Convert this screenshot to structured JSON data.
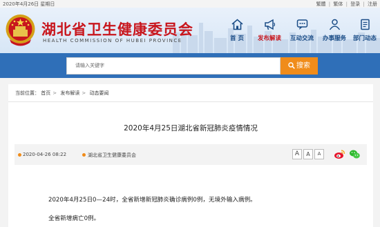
{
  "topbar": {
    "date": "2020年4月26日 星期日",
    "links": [
      "繁體",
      "繁体",
      "登录",
      "注册"
    ]
  },
  "header": {
    "title": "湖北省卫生健康委员会",
    "subtitle": "HEALTH COMMISSION OF HUBEI PROVINCE",
    "nav": [
      {
        "label": "首 页",
        "icon": "home-icon"
      },
      {
        "label": "发布解读",
        "icon": "megaphone-icon"
      },
      {
        "label": "互动交流",
        "icon": "chat-icon"
      },
      {
        "label": "办事服务",
        "icon": "person-icon"
      },
      {
        "label": "部门动态",
        "icon": "document-icon"
      }
    ],
    "active_nav": "发布解读",
    "title_color": "#c8161d"
  },
  "search": {
    "placeholder": "请输入关键字",
    "button_label": "搜索"
  },
  "breadcrumb": {
    "label": "当前位置：",
    "items": [
      "首页",
      "发布解读",
      "动态要闻"
    ]
  },
  "article": {
    "title": "2020年4月25日湖北省新冠肺炎疫情情况",
    "date": "2020-04-26 08:22",
    "source": "湖北省卫生健康委员会",
    "font_sizes": [
      "A",
      "A",
      "A"
    ],
    "share": [
      "weibo-icon",
      "wechat-icon"
    ],
    "paragraphs": [
      "2020年4月25日0—24时，全省新增新冠肺炎确诊病例0例，无境外输入病例。",
      "全省新增病亡0例。"
    ]
  },
  "colors": {
    "accent_blue": "#2f6fb8",
    "search_orange": "#f08c1a",
    "brand_red": "#c8161d"
  }
}
